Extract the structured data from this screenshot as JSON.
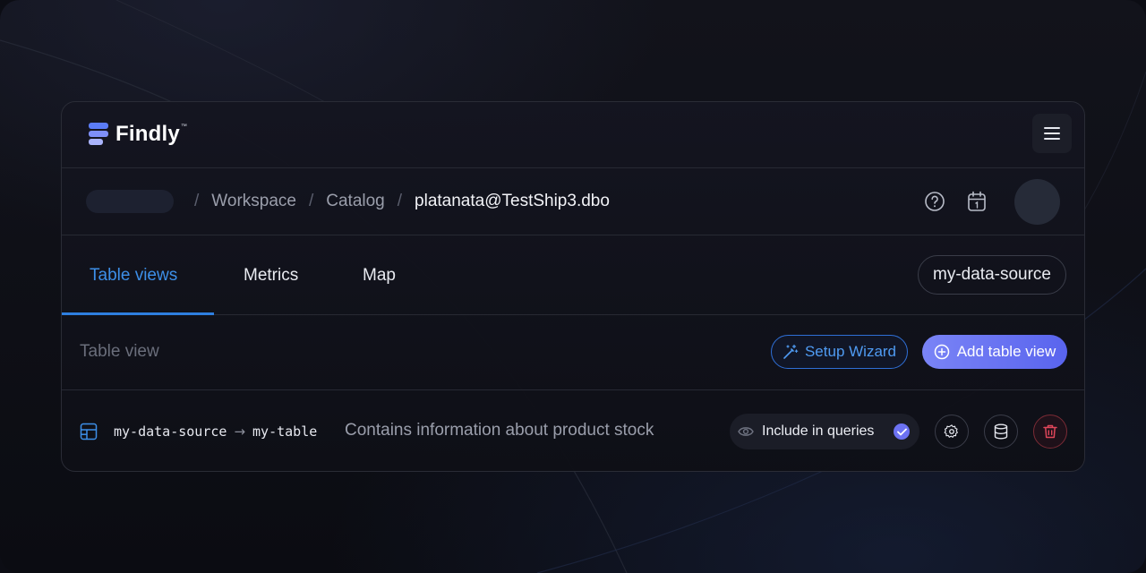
{
  "app": {
    "brand": "Findly",
    "brand_tm": "™"
  },
  "header": {
    "menu_icon": "hamburger-menu-icon"
  },
  "breadcrumb": {
    "items": [
      {
        "label": "Workspace"
      },
      {
        "label": "Catalog"
      },
      {
        "label": "platanata@TestShip3.dbo"
      }
    ],
    "separator": "/",
    "icons": [
      "help-circle-icon",
      "calendar-icon"
    ]
  },
  "tabs": [
    {
      "label": "Table views",
      "active": true
    },
    {
      "label": "Metrics",
      "active": false
    },
    {
      "label": "Map",
      "active": false
    }
  ],
  "data_source": {
    "label": "my-data-source"
  },
  "section": {
    "title": "Table view",
    "setup_wizard_label": "Setup Wizard",
    "add_table_view_label": "Add table view"
  },
  "table_view": {
    "source": "my-data-source",
    "arrow": "→",
    "table": "my-table",
    "description": "Contains information about product stock",
    "include_label": "Include in queries",
    "include_checked": true,
    "actions": [
      "settings-icon",
      "database-icon",
      "trash-icon"
    ]
  },
  "colors": {
    "accent_blue": "#3d8fe8",
    "primary_gradient_start": "#7a84f6",
    "primary_gradient_end": "#5964ee",
    "danger": "#e0465a"
  }
}
